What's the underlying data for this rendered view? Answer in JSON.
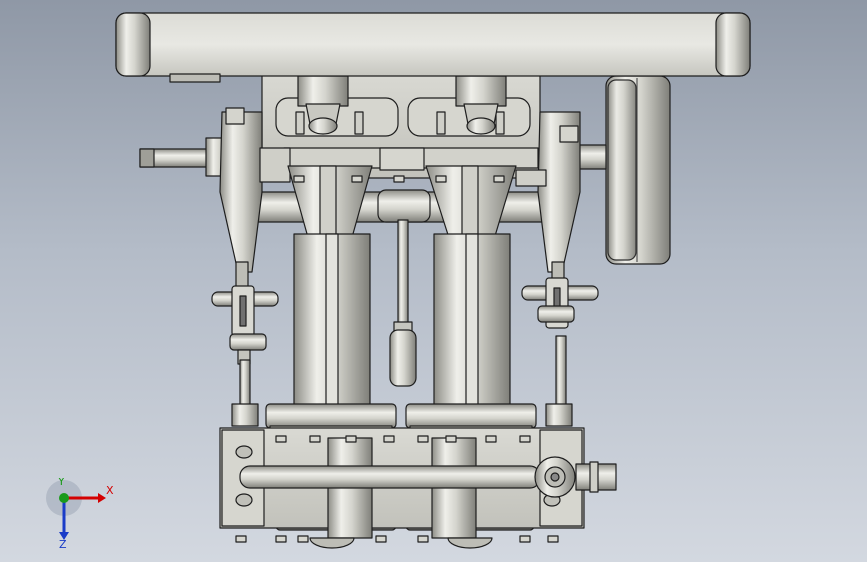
{
  "app": {
    "view": "front"
  },
  "colors": {
    "background_top": "#8f98a6",
    "background_bottom": "#d3d8e0",
    "metal_light": "#eeeeea",
    "metal_mid": "#c9c9c2",
    "metal_dark": "#8a8a84",
    "outline": "#1e1e1e",
    "axis_x": "#d40000",
    "axis_y": "#1a9a1a",
    "axis_z": "#1a3cc8"
  },
  "triad": {
    "x_label": "X",
    "y_label": "Y",
    "z_label": "Z"
  },
  "model": {
    "parts": [
      "top-plate",
      "engine-frame",
      "crankshaft",
      "flywheel",
      "eccentric-left",
      "eccentric-right",
      "connecting-rod-left",
      "connecting-rod-right",
      "piston-rod-left",
      "piston-rod-right",
      "lubricator",
      "cylinder-left",
      "cylinder-right",
      "valve-chest",
      "steam-pipe"
    ]
  }
}
